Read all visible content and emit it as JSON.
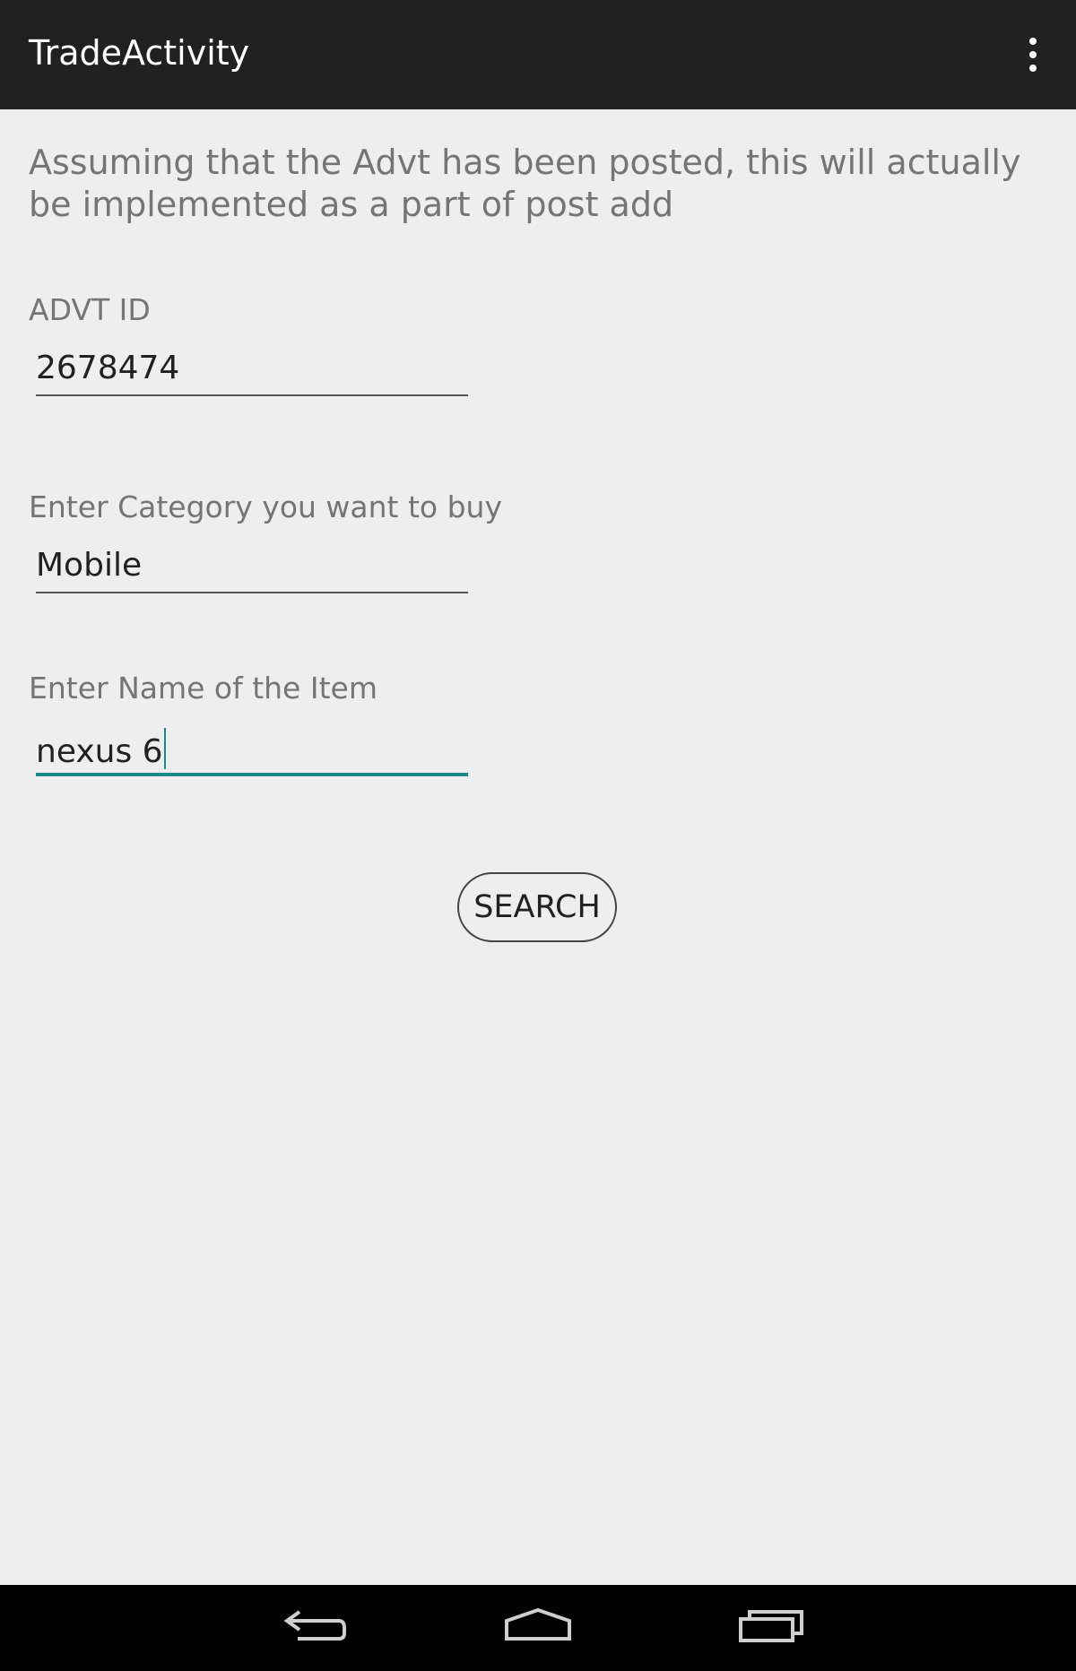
{
  "app_bar": {
    "title": "TradeActivity",
    "overflow_icon": "more-vert-icon"
  },
  "intro_text": "Assuming that the Advt has been posted, this will actually be implemented as a part of post add",
  "form": {
    "advt_id": {
      "label": "ADVT ID",
      "value": "2678474"
    },
    "category": {
      "label": "Enter Category you want to buy",
      "value": "Mobile"
    },
    "item_name": {
      "label": "Enter Name of the Item",
      "value": "nexus 6"
    }
  },
  "search_button": {
    "label": "SEARCH"
  },
  "nav_bar": {
    "back_icon": "back-icon",
    "home_icon": "home-icon",
    "recents_icon": "recents-icon"
  },
  "colors": {
    "app_bar": "#212121",
    "background": "#eeeeee",
    "accent": "#1a8a8a",
    "nav_bar": "#000000"
  }
}
